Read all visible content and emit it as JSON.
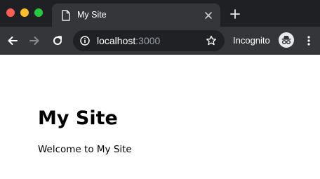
{
  "browser": {
    "tab": {
      "title": "My Site",
      "icon": "document-icon"
    },
    "address_bar": {
      "host": "localhost",
      "port": ":3000",
      "icon": "info-icon"
    },
    "profile": {
      "label": "Incognito",
      "icon": "incognito-icon"
    },
    "colors": {
      "tabstrip_bg": "#1f2023",
      "toolbar_bg": "#35363a",
      "omnibox_bg": "#202124",
      "close": "#fe5f57",
      "minimize": "#febc2e",
      "maximize": "#28c840"
    }
  },
  "page": {
    "heading": "My Site",
    "text": "Welcome to My Site"
  }
}
